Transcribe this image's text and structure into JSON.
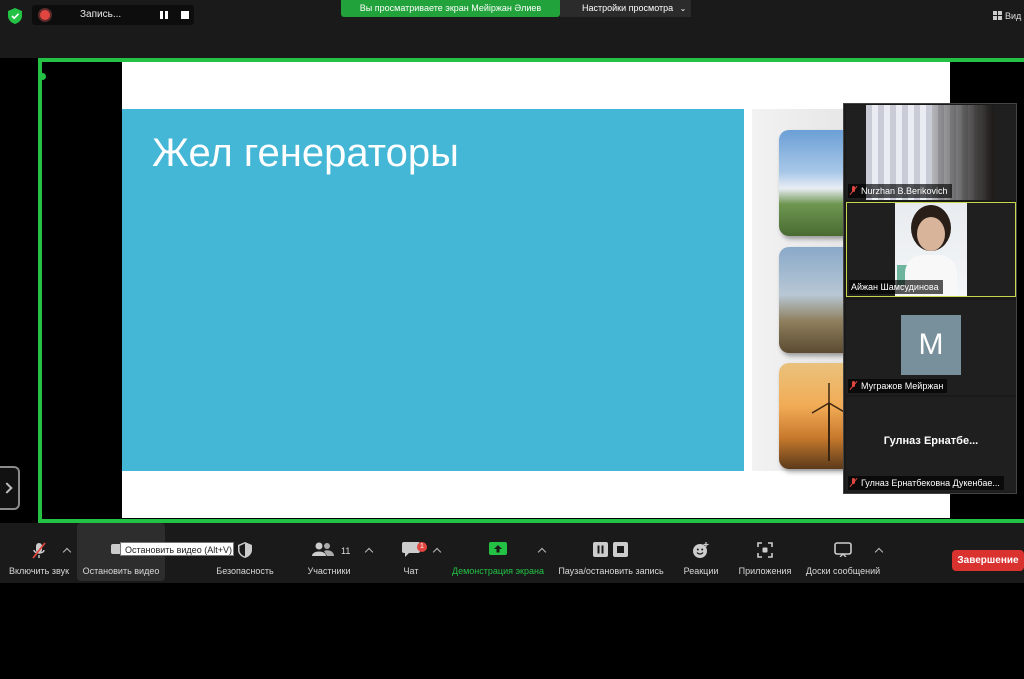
{
  "topbar": {
    "recording_label": "Запись...",
    "share_banner": "Вы просматриваете экран Мейіржан Әлиев",
    "view_options": "Настройки просмотра",
    "view_mode": "Вид"
  },
  "slide": {
    "title": "Жел генераторы"
  },
  "participants": [
    {
      "name": "Nurzhan B.Berikovich",
      "muted": true
    },
    {
      "name": "Айжан Шамсудинова",
      "muted": false
    },
    {
      "name": "Мугражов Мейржан",
      "muted": true,
      "avatar_letter": "M"
    },
    {
      "name": "Гулназ Ернатбековна Дукенбае...",
      "muted": true,
      "tile_title": "Гулназ  Ернатбе..."
    }
  ],
  "toolbar": {
    "mute": "Включить звук",
    "video": "Остановить видео",
    "video_tooltip": "Остановить видео (Alt+V)",
    "security": "Безопасность",
    "participants": "Участники",
    "participants_count": "11",
    "chat": "Чат",
    "chat_badge": "1",
    "share": "Демонстрация экрана",
    "record": "Пауза/остановить запись",
    "reactions": "Реакции",
    "apps": "Приложения",
    "whiteboards": "Доски сообщений",
    "end": "Завершение"
  },
  "colors": {
    "share_green": "#23c245",
    "slide_blue": "#44b6d6",
    "end_red": "#d9322f",
    "active_speaker": "#c8d84c"
  }
}
